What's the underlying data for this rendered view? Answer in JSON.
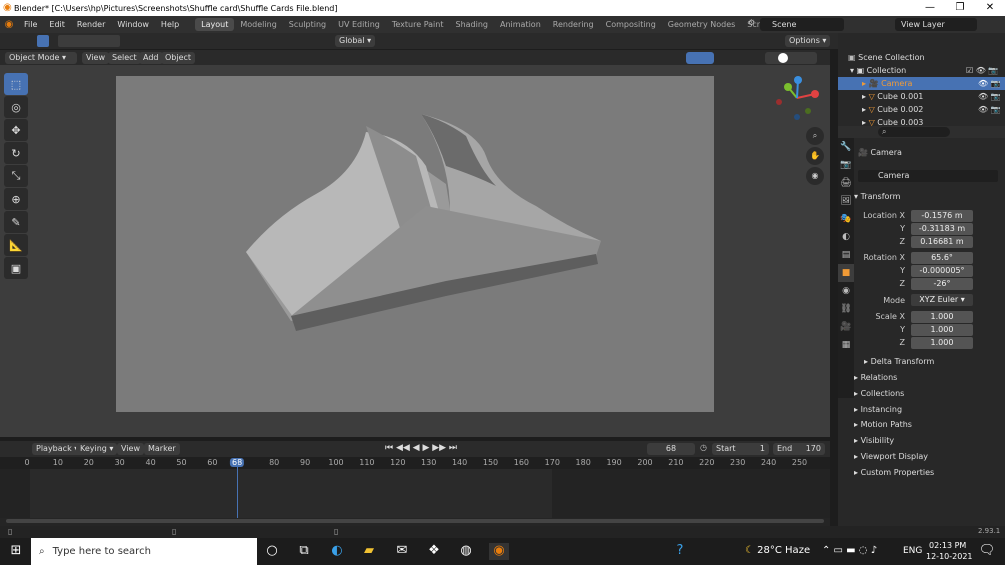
{
  "window": {
    "title": "Blender* [C:\\Users\\hp\\Pictures\\Screenshots\\Shuffle card\\Shuffle Cards File.blend]",
    "min": "—",
    "max": "❐",
    "close": "✕"
  },
  "menus": [
    "File",
    "Edit",
    "Render",
    "Window",
    "Help"
  ],
  "workspaces": [
    "Layout",
    "Modeling",
    "Sculpting",
    "UV Editing",
    "Texture Paint",
    "Shading",
    "Animation",
    "Rendering",
    "Compositing",
    "Geometry Nodes",
    "Scripting"
  ],
  "active_workspace": "Layout",
  "scene": {
    "name": "Scene",
    "view_layer": "View Layer"
  },
  "header2": {
    "transform": "Global",
    "options": "Options"
  },
  "viewport_header": {
    "mode": "Object Mode",
    "view": "View",
    "select": "Select",
    "add": "Add",
    "object": "Object"
  },
  "timeline": {
    "playback": "Playback",
    "keying": "Keying",
    "view": "View",
    "marker": "Marker",
    "current_frame": "68",
    "start_label": "Start",
    "start": "1",
    "end_label": "End",
    "end": "170",
    "ticks": [
      "0",
      "10",
      "20",
      "30",
      "40",
      "50",
      "60",
      "68",
      "80",
      "90",
      "100",
      "110",
      "120",
      "130",
      "140",
      "150",
      "160",
      "170",
      "180",
      "190",
      "200",
      "210",
      "220",
      "230",
      "240",
      "250"
    ]
  },
  "outliner": {
    "scene_collection": "Scene Collection",
    "collection": "Collection",
    "items": [
      "Camera",
      "Cube 0.001",
      "Cube 0.002",
      "Cube 0.003"
    ]
  },
  "properties": {
    "object_name": "Camera",
    "object_field": "Camera",
    "transform_label": "Transform",
    "location_label": "Location X",
    "loc_x": "-0.1576 m",
    "loc_y": "-0.31183 m",
    "loc_z": "0.16681 m",
    "rotation_label": "Rotation X",
    "rot_x": "65.6°",
    "rot_y": "-0.000005°",
    "rot_z": "-26°",
    "mode_label": "Mode",
    "mode": "XYZ Euler",
    "scale_label": "Scale X",
    "scale_x": "1.000",
    "scale_y": "1.000",
    "scale_z": "1.000",
    "y_label": "Y",
    "z_label": "Z",
    "delta": "Delta Transform",
    "sections": [
      "Relations",
      "Collections",
      "Instancing",
      "Motion Paths",
      "Visibility",
      "Viewport Display",
      "Custom Properties"
    ]
  },
  "version": "2.93.1",
  "taskbar": {
    "search_placeholder": "Type here to search",
    "weather": "28°C  Haze",
    "lang": "ENG",
    "time": "02:13 PM",
    "date": "12-10-2021"
  },
  "colors": {
    "accent": "#4772b3",
    "orange": "#f19b36",
    "playhead": "#4772b3"
  }
}
